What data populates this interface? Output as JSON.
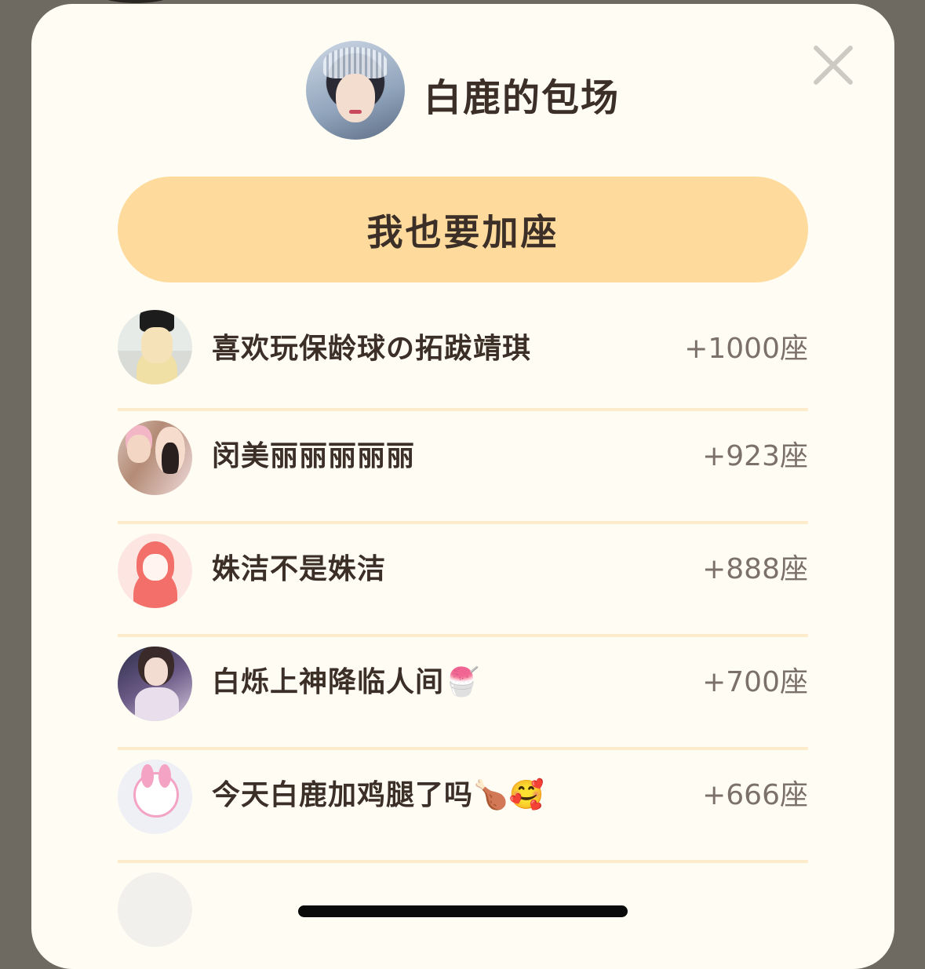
{
  "header": {
    "title": "白鹿的包场",
    "avatar_icon": "portrait-avatar-icon",
    "close_icon": "close-icon"
  },
  "join_button": {
    "label": "我也要加座"
  },
  "supporters": [
    {
      "name": "喜欢玩保龄球の拓跋靖琪",
      "seats": "+1000座"
    },
    {
      "name": "闵美丽丽丽丽丽",
      "seats": "+923座"
    },
    {
      "name": "姝洁不是姝洁",
      "seats": "+888座"
    },
    {
      "name": "白烁上神降临人间🍧",
      "seats": "+700座"
    },
    {
      "name": "今天白鹿加鸡腿了吗🍗🥰",
      "seats": "+666座"
    },
    {
      "name": "",
      "seats": ""
    }
  ],
  "colors": {
    "sheet_background": "#fffdf3",
    "button_background": "#fedb9c",
    "divider": "#fdeccb",
    "text_primary": "#3b2f27",
    "text_secondary": "#7b716a"
  }
}
